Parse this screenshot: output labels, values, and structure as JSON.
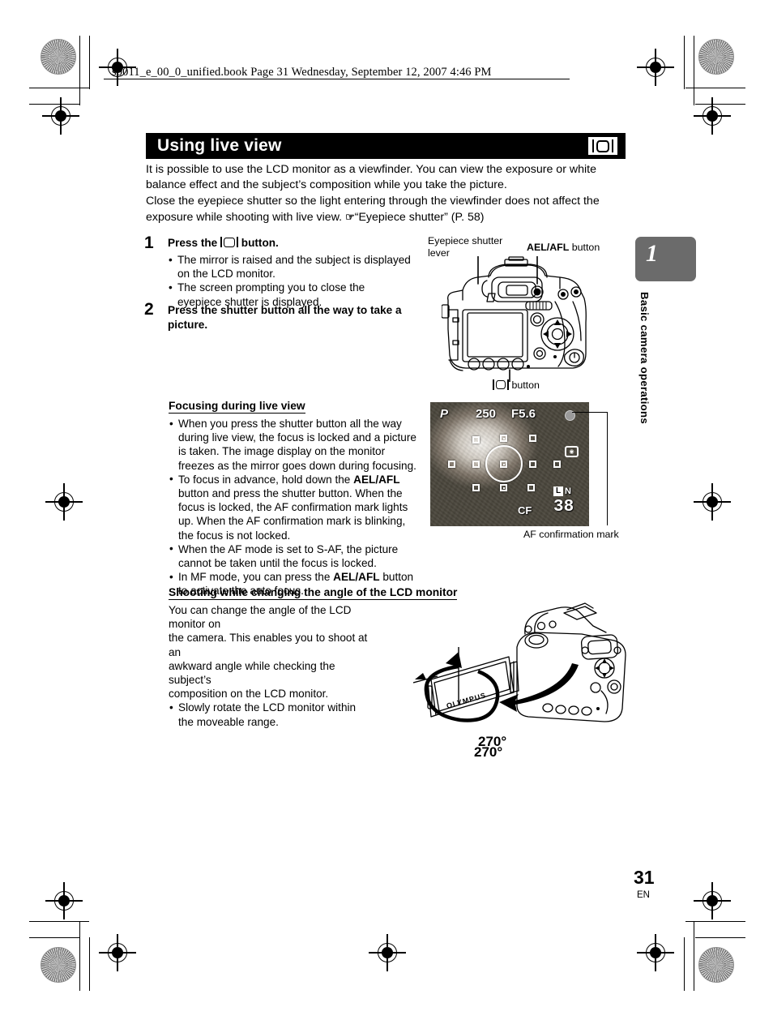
{
  "header": {
    "file_line": "s0011_e_00_0_unified.book  Page 31  Wednesday, September 12, 2007  4:46 PM"
  },
  "title_bar": {
    "title": "Using live view",
    "icon": "live-view-monitor-icon"
  },
  "intro": {
    "line1": "It is possible to use the LCD monitor as a viewfinder. You can view the exposure or white",
    "line2": "balance effect and the subject’s composition while you take the picture.",
    "line3": "Close the eyepiece shutter so the light entering through the viewfinder does not affect the",
    "line4_a": "exposure while shooting with live view.",
    "line4_hand": "☞",
    "line4_b": "“Eyepiece shutter” (P. 58)"
  },
  "steps": [
    {
      "num": "1",
      "head_a": "Press the",
      "head_icon": "live-view-monitor-icon",
      "head_b": "button.",
      "bullets": [
        "The mirror is raised and the subject is displayed on the LCD monitor.",
        "The screen prompting you to close the eyepiece shutter is displayed."
      ]
    },
    {
      "num": "2",
      "head_a": "Press the shutter button all the way to take a picture.",
      "bullets": []
    }
  ],
  "section_focusing": {
    "heading": "Focusing during live view",
    "bullets": [
      "When you press the shutter button all the way during live view, the focus is locked and a picture is taken. The image display on the monitor freezes as the mirror goes down during focusing.",
      "To focus in advance, hold down the AEL/AFL button and press the shutter button. When the focus is locked, the AF confirmation mark lights up. When the AF confirmation mark is blinking, the focus is not locked.",
      "When the AF mode is set to S-AF, the picture cannot be taken until the focus is locked.",
      "In MF mode, you can press the AEL/AFL button to activate the auto focus."
    ]
  },
  "section_angle": {
    "heading": "Shooting while changing the angle of the LCD monitor",
    "paragraph_lines": [
      "You can change the angle of the LCD monitor on",
      "the camera. This enables you to shoot at an",
      "awkward angle while checking the subject’s",
      "composition on the LCD monitor."
    ],
    "bullet_lines": [
      "Slowly rotate the LCD monitor within the",
      "moveable range."
    ],
    "rotation_label": "270°"
  },
  "figure_camera_back": {
    "label_eyepiece_line1": "Eyepiece shutter",
    "label_eyepiece_line2": "lever",
    "label_aelafl_bold": "AEL/AFL",
    "label_aelafl_rest": "button",
    "label_bottom_icon": "live-view-monitor-icon",
    "label_bottom_rest": "button"
  },
  "figure_lcd": {
    "mode": "P",
    "shutter_speed": "250",
    "aperture": "F5.6",
    "card": "CF",
    "frames_remaining": "38",
    "quality_box": "L",
    "quality_n": "N",
    "metering_icon": "esp-metering-icon",
    "af_confirmation_label": "AF confirmation mark"
  },
  "side_tab": {
    "chapter_number": "1",
    "chapter_title": "Basic camera operations",
    "color": "#6b6b6b"
  },
  "footer": {
    "page_number": "31",
    "language": "EN"
  }
}
